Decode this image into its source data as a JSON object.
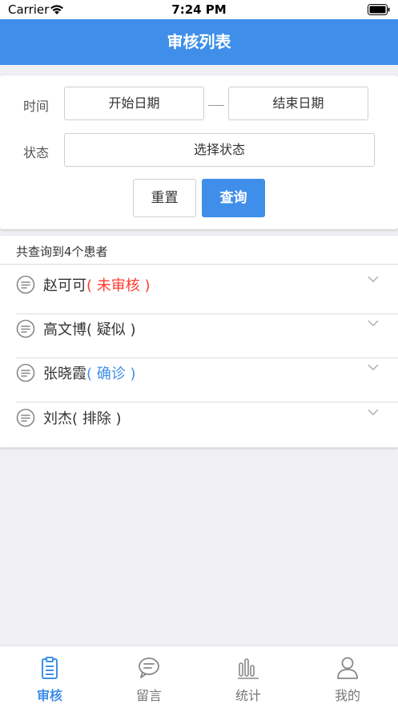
{
  "status_bar": {
    "carrier": "Carrier",
    "time": "7:24 PM"
  },
  "header": {
    "title": "审核列表"
  },
  "filter": {
    "time_label": "时间",
    "start_date": "开始日期",
    "end_date": "结束日期",
    "status_label": "状态",
    "status_select": "选择状态",
    "reset_label": "重置",
    "query_label": "查询"
  },
  "results": {
    "count_text": "共查询到4个患者",
    "patients": [
      {
        "name": "赵可可",
        "status": "( 未审核 )",
        "status_color": "#ff3b30"
      },
      {
        "name": "高文博",
        "status": "( 疑似 )",
        "status_color": "#333333"
      },
      {
        "name": "张晓霞",
        "status": "( 确诊 )",
        "status_color": "#3f8fea"
      },
      {
        "name": "刘杰",
        "status": "( 排除 )",
        "status_color": "#333333"
      }
    ]
  },
  "tabs": [
    {
      "label": "审核",
      "icon": "clipboard-icon",
      "active": true
    },
    {
      "label": "留言",
      "icon": "chat-icon",
      "active": false
    },
    {
      "label": "统计",
      "icon": "bar-chart-icon",
      "active": false
    },
    {
      "label": "我的",
      "icon": "user-icon",
      "active": false
    }
  ],
  "colors": {
    "primary": "#3f8fea",
    "pending": "#ff3b30"
  }
}
